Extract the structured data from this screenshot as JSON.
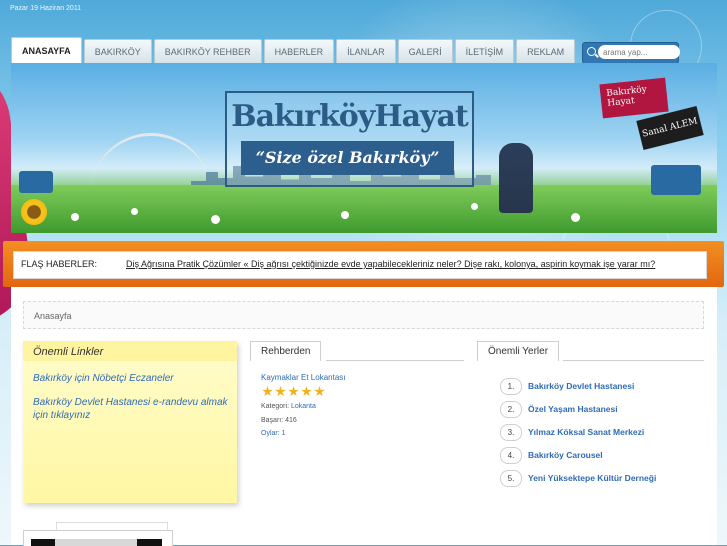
{
  "date": "Pazar 19 Haziran 2011",
  "nav": {
    "items": [
      "ANASAYFA",
      "BAKIRKÖY",
      "BAKIRKÖY REHBER",
      "HABERLER",
      "İLANLAR",
      "GALERİ",
      "İLETİŞİM",
      "REKLAM"
    ],
    "active": "ANASAYFA"
  },
  "search": {
    "placeholder": "arama yap..."
  },
  "banner": {
    "logo": "BakırköyHayat",
    "slogan": "“Size özel Bakırköy”",
    "badge1": "Bakırköy Hayat",
    "badge2": "Sanal ALEM"
  },
  "flash": {
    "label": "FLAŞ HABERLER:",
    "ticker": "Diş Ağrısına Pratik Çözümler « Diş ağrısı çektiğinizde evde yapabilecekleriniz neler? Dişe rakı, kolonya, aspirin koymak işe yarar mı?"
  },
  "breadcrumb": "Anasayfa",
  "important_links": {
    "title": "Önemli Linkler",
    "items": [
      "Bakırköy için Nöbetçi Eczaneler",
      "Bakırköy Devlet Hastanesi e-randevu almak için tıklayınız"
    ]
  },
  "rehber": {
    "title": "Rehberden",
    "item": "Kaymaklar Et Lokantası",
    "rating": 5,
    "category_label": "Kategori:",
    "category": "Lokanta",
    "views_label": "Başarı:",
    "views": "416",
    "votes_label": "Oylar:",
    "votes": "1"
  },
  "places": {
    "title": "Önemli Yerler",
    "items": [
      {
        "num": "1.",
        "name": "Bakırköy Devlet Hastanesi"
      },
      {
        "num": "2.",
        "name": "Özel Yaşam Hastanesi"
      },
      {
        "num": "3.",
        "name": "Yılmaz Köksal Sanat Merkezi"
      },
      {
        "num": "4.",
        "name": "Bakırköy Carousel"
      },
      {
        "num": "5.",
        "name": "Yeni Yüksektepe Kültür Derneği"
      }
    ]
  },
  "colors": {
    "accent": "#2f6bb8",
    "flash_bar": "#ef7d1a",
    "slogan_bg": "#2d5f8e",
    "sticky": "#fff7a3"
  }
}
